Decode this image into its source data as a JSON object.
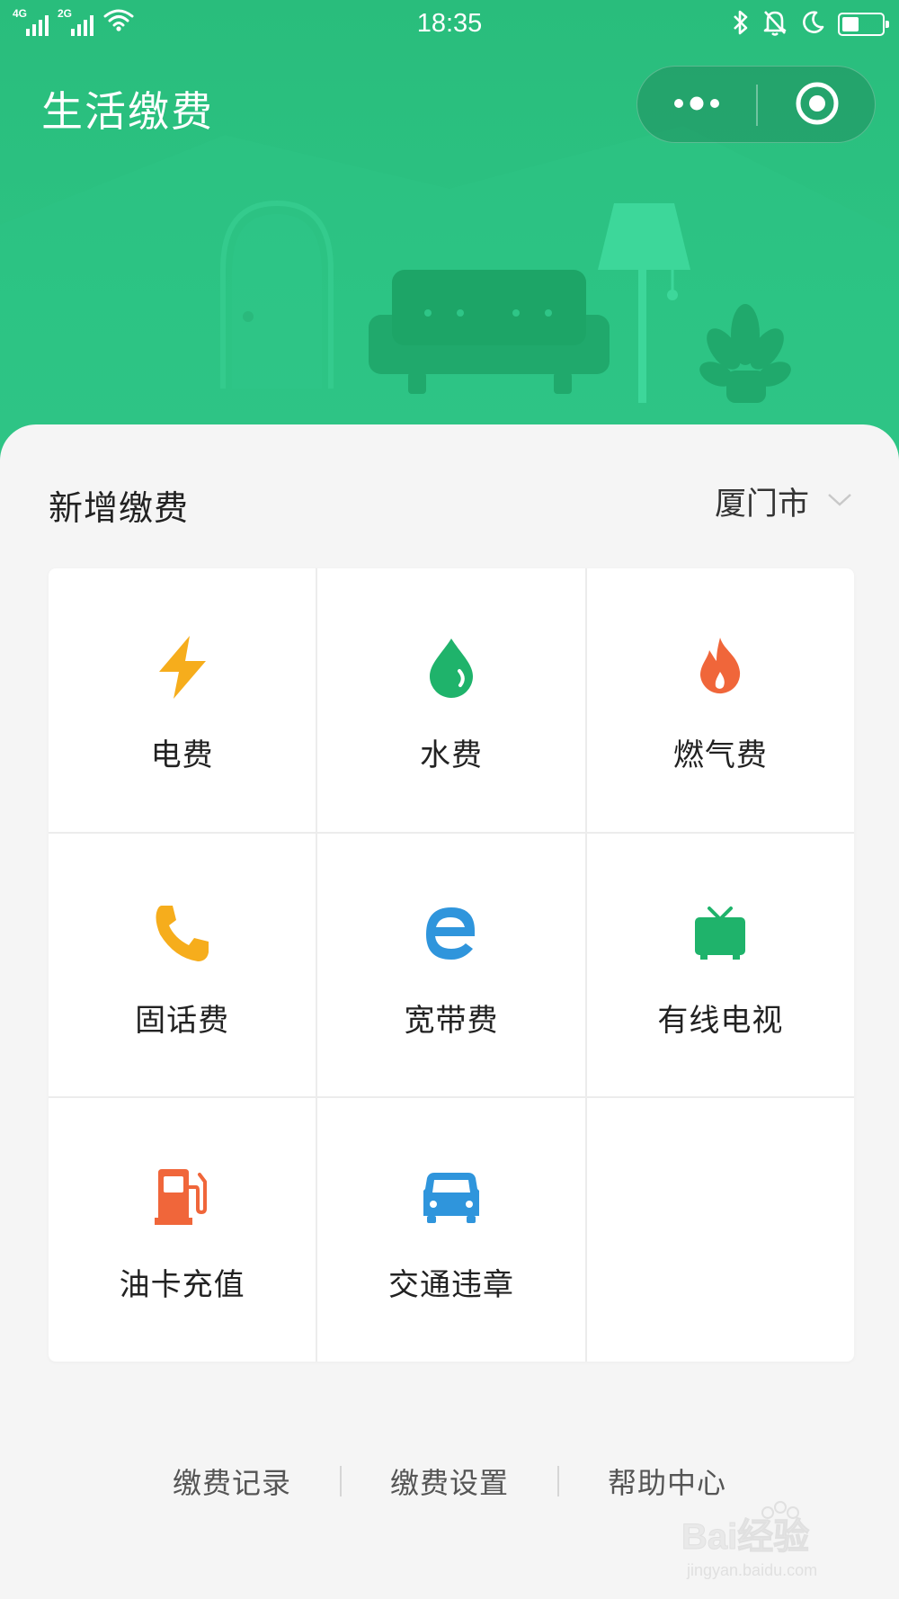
{
  "status_bar": {
    "time": "18:35",
    "sim1": "4G",
    "sim2": "2G",
    "icons": [
      "signal-icon",
      "wifi-icon",
      "bluetooth-icon",
      "alarm-icon",
      "moon-icon",
      "battery-icon"
    ],
    "battery_level": 0.45
  },
  "header": {
    "title": "生活缴费",
    "capsule_icons": [
      "more-icon",
      "close-target-icon"
    ]
  },
  "section": {
    "title": "新增缴费",
    "city": "厦门市"
  },
  "services": [
    {
      "label": "电费",
      "icon": "lightning-icon",
      "color": "#f6ad1c"
    },
    {
      "label": "水费",
      "icon": "water-drop-icon",
      "color": "#1fb36b"
    },
    {
      "label": "燃气费",
      "icon": "flame-icon",
      "color": "#f0663a"
    },
    {
      "label": "固话费",
      "icon": "phone-icon",
      "color": "#f6ad1c"
    },
    {
      "label": "宽带费",
      "icon": "broadband-e-icon",
      "color": "#2f95dc"
    },
    {
      "label": "有线电视",
      "icon": "tv-icon",
      "color": "#1fb36b"
    },
    {
      "label": "油卡充值",
      "icon": "fuel-pump-icon",
      "color": "#f0663a"
    },
    {
      "label": "交通违章",
      "icon": "car-icon",
      "color": "#2f95dc"
    }
  ],
  "footer": {
    "links": [
      "缴费记录",
      "缴费设置",
      "帮助中心"
    ]
  },
  "watermark": {
    "text": "Bai经验",
    "url": "jingyan.baidu.com"
  },
  "colors": {
    "header_green": "#2cc282",
    "card_bg": "#f5f5f5"
  }
}
